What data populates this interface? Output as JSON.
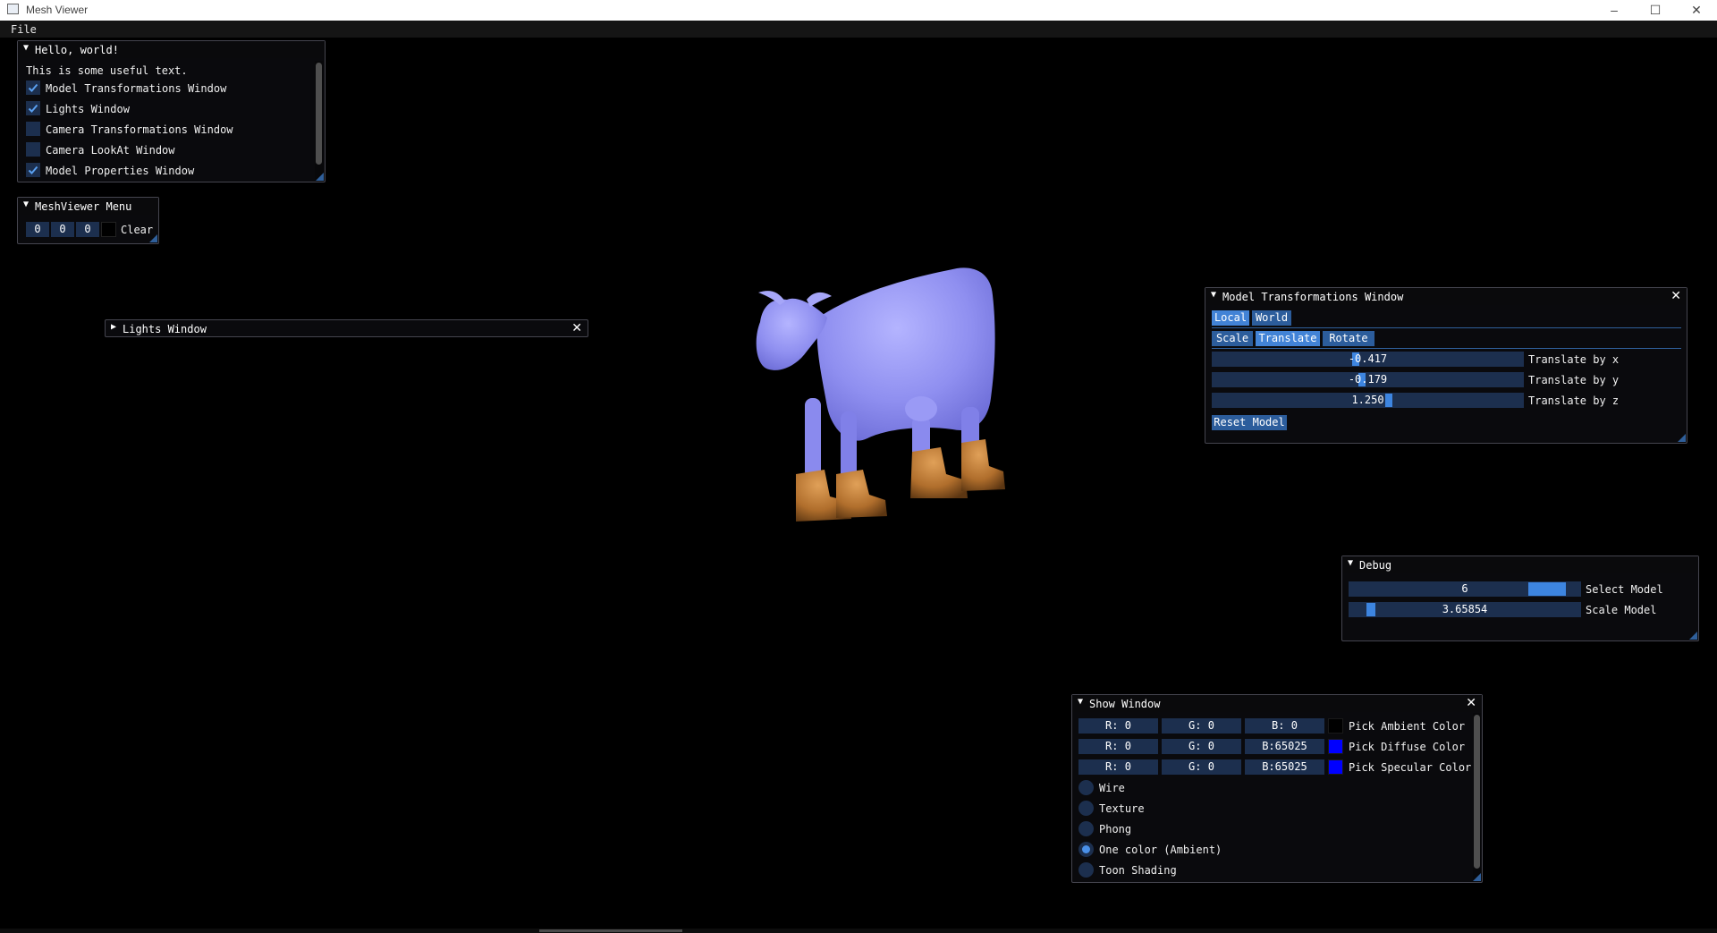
{
  "titlebar": {
    "title": "Mesh Viewer",
    "minimize": "–",
    "maximize": "☐",
    "close": "✕"
  },
  "menubar": {
    "file": "File"
  },
  "hello_window": {
    "title": "Hello, world!",
    "text": "This is some useful text.",
    "checkboxes": [
      {
        "label": "Model Transformations Window",
        "checked": true
      },
      {
        "label": "Lights Window",
        "checked": true
      },
      {
        "label": "Camera Transformations Window",
        "checked": false
      },
      {
        "label": "Camera LookAt Window",
        "checked": false
      },
      {
        "label": "Model Properties Window",
        "checked": true
      }
    ]
  },
  "meshviewer_menu": {
    "title": "MeshViewer Menu",
    "r": "0",
    "g": "0",
    "b": "0",
    "clear_label": "Clear",
    "color": "#000000"
  },
  "lights_window": {
    "title": "Lights Window"
  },
  "model_transform": {
    "title": "Model Transformations Window",
    "frame_tabs": [
      "Local",
      "World"
    ],
    "mode_tabs": [
      "Scale",
      "Translate",
      "Rotate"
    ],
    "sliders": [
      {
        "value": "-0.417",
        "label": "Translate by x",
        "level": 0.46
      },
      {
        "value": "-0.179",
        "label": "Translate by y",
        "level": 0.48
      },
      {
        "value": "1.250",
        "label": "Translate by z",
        "level": 0.57
      }
    ],
    "reset_label": "Reset Model"
  },
  "debug_window": {
    "title": "Debug",
    "sliders": [
      {
        "value": "6",
        "label": "Select Model",
        "level": 0.92
      },
      {
        "value": "3.65854",
        "label": "Scale Model",
        "level": 0.08
      }
    ]
  },
  "show_window": {
    "title": "Show Window",
    "color_rows": [
      {
        "r": "R:  0",
        "g": "G:  0",
        "b": "B:  0",
        "label": "Pick Ambient Color",
        "color": "#000000"
      },
      {
        "r": "R:  0",
        "g": "G:  0",
        "b": "B:65025",
        "label": "Pick Diffuse Color",
        "color": "#0000ff"
      },
      {
        "r": "R:  0",
        "g": "G:  0",
        "b": "B:65025",
        "label": "Pick Specular Color",
        "color": "#0000ff"
      }
    ],
    "radios": [
      {
        "label": "Wire",
        "selected": false
      },
      {
        "label": "Texture",
        "selected": false
      },
      {
        "label": "Phong",
        "selected": false
      },
      {
        "label": "One color (Ambient)",
        "selected": true
      },
      {
        "label": "Toon Shading",
        "selected": false
      }
    ]
  },
  "colors": {
    "accent": "#4283d6",
    "frame": "#1c2f4e",
    "button": "#2c5d9c",
    "cow": "#9a9af5"
  }
}
